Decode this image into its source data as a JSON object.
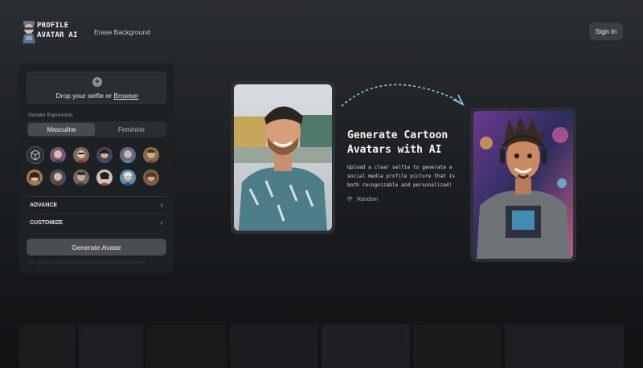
{
  "header": {
    "logo_line1": "PROFILE",
    "logo_line2": "AVATAR AI",
    "nav_link": "Erase Background",
    "signin_label": "Sign In"
  },
  "panel": {
    "drop_prefix": "Drop your selfie or ",
    "drop_link": "Browser",
    "gender_label": "Gender Expression",
    "gender_options": [
      "Masculine",
      "Feminine"
    ],
    "gender_selected": "Masculine",
    "accordions": [
      "ADVANCE",
      "CUSTOMIZE"
    ],
    "generate_label": "Generate Avatar",
    "disclaimer": "Your photos won't be used to train AI models without consent."
  },
  "hero": {
    "headline_line1": "Generate Cartoon",
    "headline_line2": "Avatars with AI",
    "subtext": "Upload a clear selfie to generate a social media profile picture that is both recognizable and personalized!",
    "random_label": "Random"
  },
  "icons": {
    "plus": "plus-circle-icon",
    "cube": "cube-icon",
    "chevron": "chevron-left-icon",
    "random": "refresh-icon"
  },
  "colors": {
    "background": "#1d2023",
    "panel": "#1e2124",
    "accent_arrow": "#8fc9ef",
    "button": "#4a4d51"
  }
}
